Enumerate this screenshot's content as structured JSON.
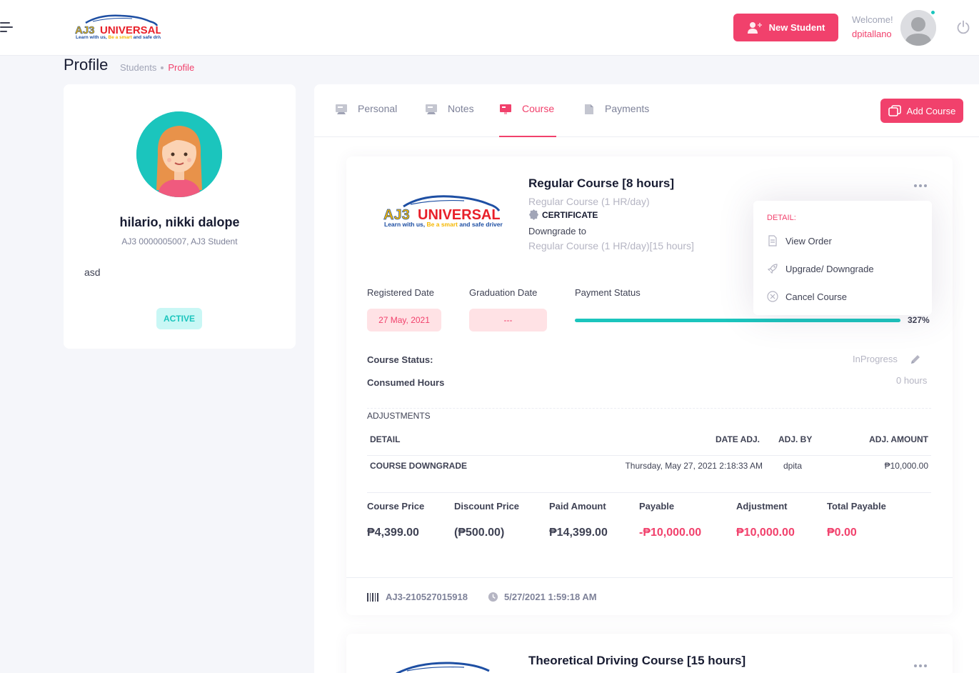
{
  "header": {
    "brand_name": "AJ3 UNIVERSAL",
    "brand_tagline": "Learn with us, Be a smart and safe driver",
    "new_student_label": "New Student",
    "welcome_label": "Welcome!",
    "username": "dpitallano"
  },
  "page": {
    "title": "Profile",
    "breadcrumb": [
      "Students",
      "Profile"
    ]
  },
  "profile": {
    "name": "hilario, nikki dalope",
    "id_line": "AJ3 0000005007, AJ3 Student",
    "note": "asd",
    "status": "ACTIVE"
  },
  "tabs": [
    {
      "label": "Personal"
    },
    {
      "label": "Notes"
    },
    {
      "label": "Course",
      "active": true
    },
    {
      "label": "Payments"
    }
  ],
  "add_course_label": "Add Course",
  "course": {
    "title": "Regular Course [8 hours]",
    "subtitle": "Regular Course (1 HR/day)",
    "certificate": "CERTIFICATE",
    "downgrade_label": "Downgrade to",
    "downgrade_value": "Regular Course (1 HR/day)[15 hours]",
    "menu": {
      "title": "DETAIL:",
      "items": [
        "View Order",
        "Upgrade/ Downgrade",
        "Cancel Course"
      ]
    },
    "registered_date_label": "Registered Date",
    "registered_date": "27 May, 2021",
    "graduation_date_label": "Graduation Date",
    "graduation_date": "---",
    "payment_status_label": "Payment Status",
    "payment_percent_text": "327%",
    "payment_fill_fraction": 1.0,
    "course_status_label": "Course Status:",
    "course_status": "InProgress",
    "consumed_hours_label": "Consumed Hours",
    "consumed_hours": "0 hours",
    "adjustments_title": "ADJUSTMENTS",
    "adjustments_headers": [
      "DETAIL",
      "DATE ADJ.",
      "ADJ. BY",
      "ADJ. AMOUNT"
    ],
    "adjustments_rows": [
      {
        "detail": "COURSE DOWNGRADE",
        "date": "Thursday, May 27, 2021 2:18:33 AM",
        "by": "dpita",
        "amount": "₱10,000.00"
      }
    ],
    "summary": [
      {
        "label": "Course Price",
        "value": "₱4,399.00",
        "color": "#3f4254"
      },
      {
        "label": "Discount Price",
        "value": "(₱500.00)",
        "color": "#3f4254"
      },
      {
        "label": "Paid Amount",
        "value": "₱14,399.00",
        "color": "#3f4254"
      },
      {
        "label": "Payable",
        "value": "-₱10,000.00",
        "color": "#f1416c"
      },
      {
        "label": "Adjustment",
        "value": "₱10,000.00",
        "color": "#f1416c"
      },
      {
        "label": "Total Payable",
        "value": "₱0.00",
        "color": "#f1416c"
      }
    ],
    "order_code": "AJ3-210527015918",
    "order_time": "5/27/2021 1:59:18 AM"
  },
  "course2": {
    "title": "Theoretical Driving Course [15 hours]"
  },
  "colors": {
    "accent": "#f1416c",
    "success": "#1bc5bd"
  }
}
